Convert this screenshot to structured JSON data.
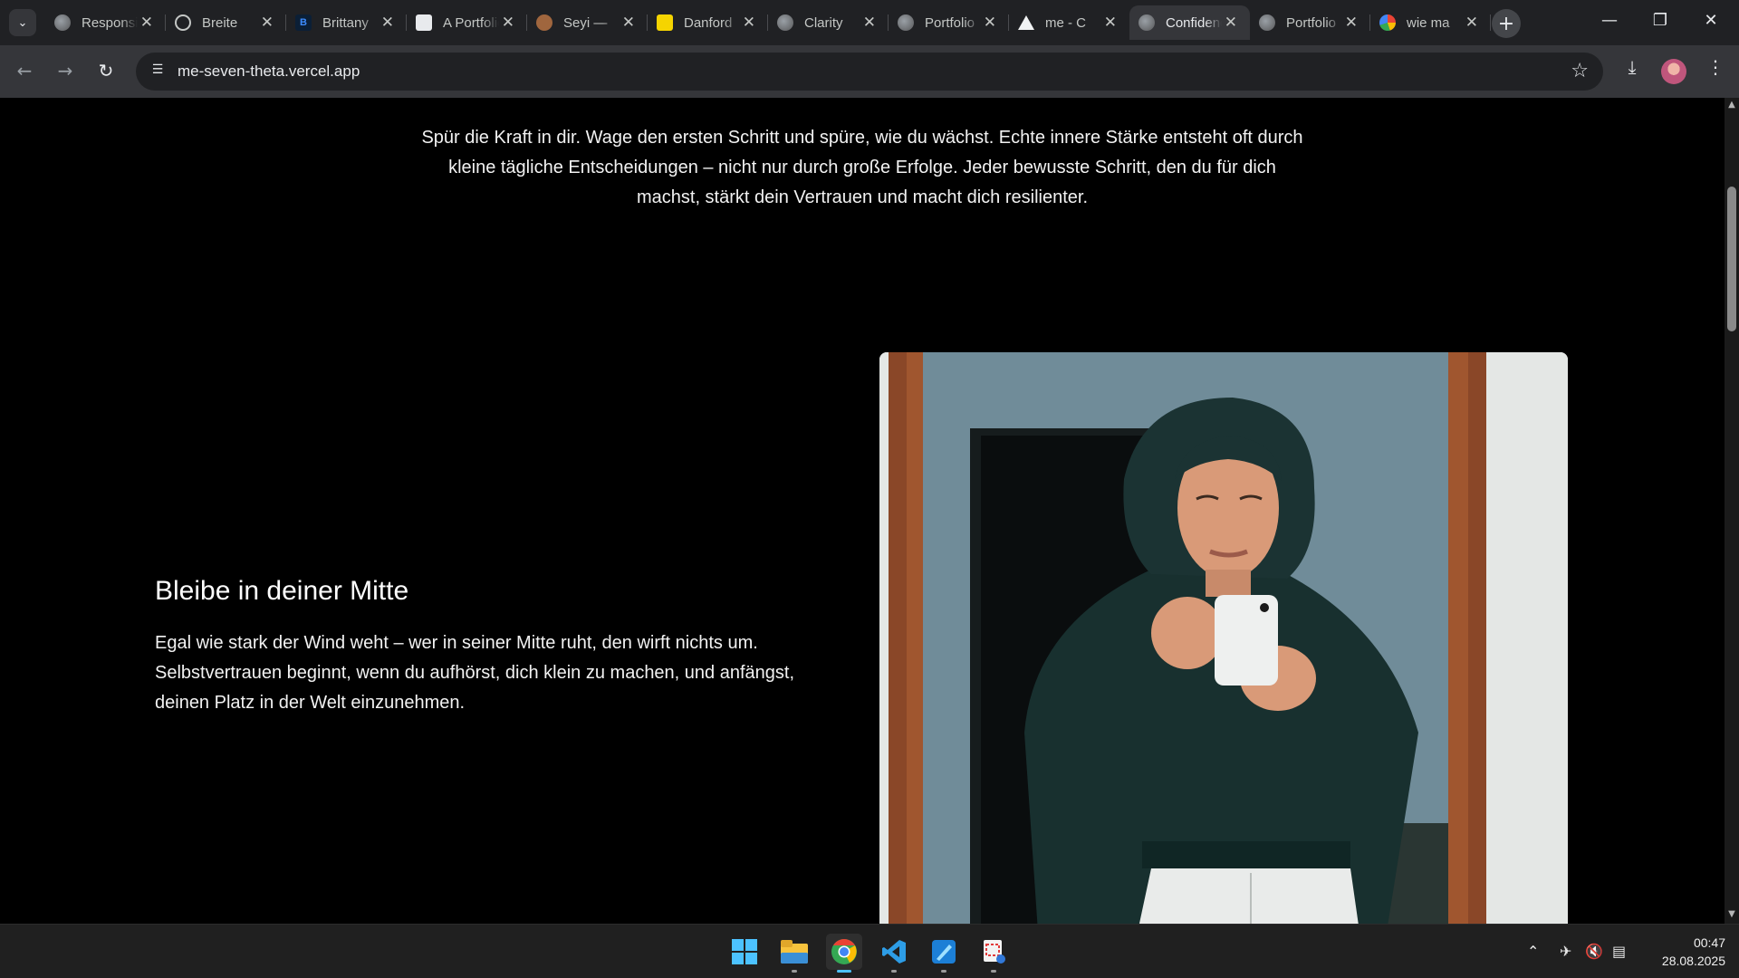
{
  "browser": {
    "tabs": [
      {
        "title": "Responsive",
        "favicon": "globe-icon"
      },
      {
        "title": "Breite",
        "favicon": "chatgpt-icon"
      },
      {
        "title": "Brittany",
        "favicon": "b-icon"
      },
      {
        "title": "A Portfolio",
        "favicon": "codepen-icon"
      },
      {
        "title": "Seyi —",
        "favicon": "avatar-icon"
      },
      {
        "title": "Danford",
        "favicon": "lamp-icon"
      },
      {
        "title": "Clarity",
        "favicon": "globe-icon"
      },
      {
        "title": "Portfolio",
        "favicon": "globe-icon"
      },
      {
        "title": "me - C",
        "favicon": "vercel-icon"
      },
      {
        "title": "Confidence",
        "favicon": "globe-icon",
        "active": true
      },
      {
        "title": "Portfolio",
        "favicon": "globe-icon"
      },
      {
        "title": "wie ma",
        "favicon": "google-icon"
      }
    ],
    "close_glyph": "✕",
    "url": "me-seven-theta.vercel.app",
    "accent_color": "#4cc2ff"
  },
  "page": {
    "intro_text": "Spür die Kraft in dir. Wage den ersten Schritt und spüre, wie du wächst. Echte innere Stärke entsteht oft durch kleine tägliche Entscheidungen – nicht nur durch große Erfolge. Jeder bewusste Schritt, den du für dich machst, stärkt dein Vertrauen und macht dich resilienter.",
    "section_heading": "Bleibe in deiner Mitte",
    "section_body": "Egal wie stark der Wind weht – wer in seiner Mitte ruht, den wirft nichts um. Selbstvertrauen beginnt, wenn du aufhörst, dich klein zu machen, und anfängst, deinen Platz in der Welt einzunehmen."
  },
  "taskbar": {
    "apps": [
      "start-icon",
      "file-explorer-icon",
      "chrome-icon",
      "vscode-icon",
      "paint-icon",
      "snipping-tool-icon"
    ],
    "active_app": "chrome-icon",
    "time": "00:47",
    "date": "28.08.2025"
  }
}
